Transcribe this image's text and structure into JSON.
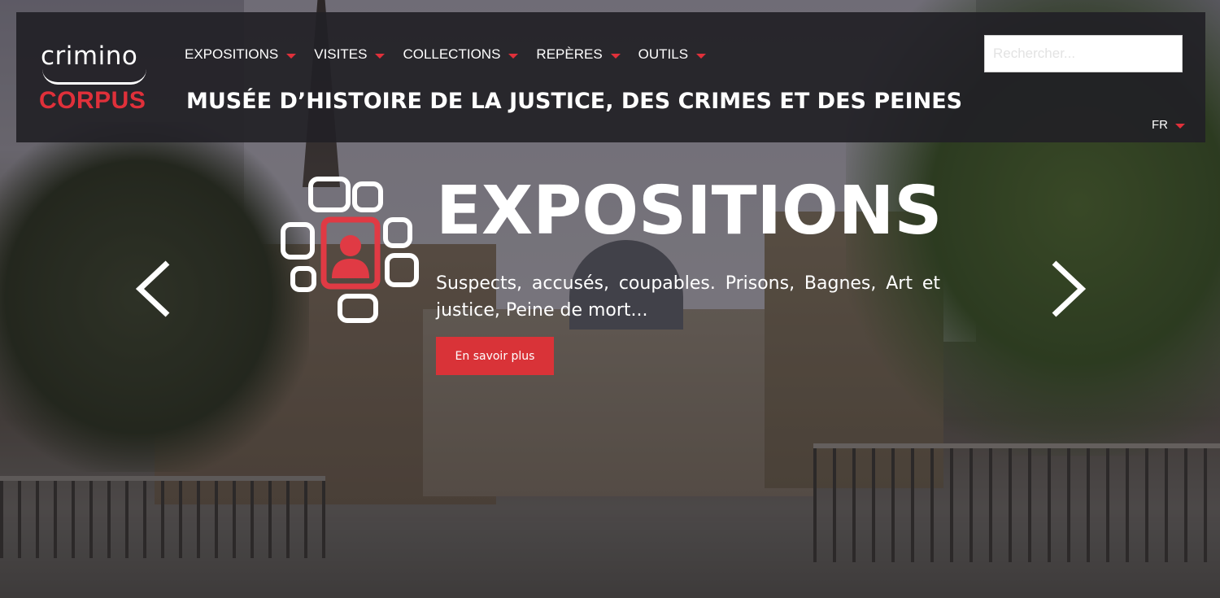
{
  "logo": {
    "line1": "crimino",
    "line2": "CORPUS"
  },
  "nav": {
    "items": [
      {
        "label": "EXPOSITIONS"
      },
      {
        "label": "VISITES"
      },
      {
        "label": "COLLECTIONS"
      },
      {
        "label": "REPÈRES"
      },
      {
        "label": "OUTILS"
      }
    ]
  },
  "site_title": "MUSÉE D’HISTOIRE DE LA JUSTICE, DES CRIMES ET DES PEINES",
  "search": {
    "placeholder": "Rechercher...",
    "value": ""
  },
  "language": {
    "current": "FR"
  },
  "slide": {
    "title": "EXPOSITIONS",
    "text": "Suspects, accusés, coupables. Prisons, Bagnes, Art et justice, Peine de mort...",
    "button": "En savoir plus",
    "icon": "exhibition-grid-icon"
  },
  "carousel": {
    "prev_icon": "chevron-left-icon",
    "next_icon": "chevron-right-icon"
  },
  "colors": {
    "accent": "#e0303a",
    "header_bg": "#222126",
    "button_bg": "#d93338"
  }
}
